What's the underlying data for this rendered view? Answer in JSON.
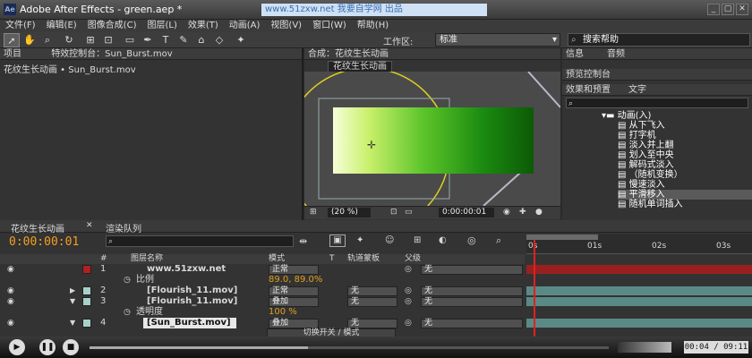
{
  "title": "Adobe After Effects - green.aep *",
  "watermark": "www.51zxw.net 我要自学网 出品",
  "window_buttons": [
    "_",
    "▢",
    "✕"
  ],
  "menu": [
    "文件(F)",
    "编辑(E)",
    "图像合成(C)",
    "图层(L)",
    "效果(T)",
    "动画(A)",
    "视图(V)",
    "窗口(W)",
    "帮助(H)"
  ],
  "toolbar": {
    "workspace_label": "工作区:",
    "workspace_value": "标准",
    "search_value": "搜索帮助"
  },
  "project_panel": {
    "tab": "项目",
    "fx_tab": "特效控制台：Sun_Burst.mov",
    "breadcrumb": "花纹生长动画 • Sun_Burst.mov"
  },
  "comp_panel": {
    "tab": "合成：花纹生长动画",
    "comp_label": "花纹生长动画",
    "zoom": "(20 %)",
    "timecode": "0:00:00:01"
  },
  "right_panel": {
    "tab_info": "信息",
    "tab_audio": "音频",
    "tab_preview": "预览控制台",
    "tab_effects": "效果和预置",
    "tab_text": "文字",
    "folder": "动画(入)",
    "items": [
      "从下飞入",
      "打字机",
      "淡入并上翻",
      "划入至中央",
      "解码式淡入",
      "（随机变换）",
      "慢速淡入",
      "平滑移入",
      "随机单词插入"
    ],
    "selected_item": "平滑移入"
  },
  "timeline": {
    "tab_comp": "花纹生长动画",
    "tab_render": "渲染队列",
    "timecode": "0:00:00:01",
    "columns": {
      "name": "图层名称",
      "mode": "模式",
      "t": "T",
      "trkmat": "轨道蒙板",
      "parent": "父级"
    },
    "ruler": [
      "0s",
      "01s",
      "02s",
      "03s"
    ],
    "layers": [
      {
        "num": "1",
        "name": "www.51zxw.net",
        "mode": "正常",
        "trkmat": "",
        "parent": "无",
        "color": "#b02020"
      },
      {
        "num": "",
        "name": "比例",
        "value": "89.0, 89.0%",
        "sub": true
      },
      {
        "num": "2",
        "name": "[Flourish_11.mov]",
        "mode": "正常",
        "trkmat": "无",
        "parent": "无",
        "color": "#a8d0c8"
      },
      {
        "num": "3",
        "name": "[Flourish_11.mov]",
        "mode": "叠加",
        "trkmat": "无",
        "parent": "无",
        "color": "#a8d0c8"
      },
      {
        "num": "",
        "name": "透明度",
        "value": "100 %",
        "sub": true
      },
      {
        "num": "4",
        "name": "[Sun_Burst.mov]",
        "mode": "叠加",
        "trkmat": "无",
        "parent": "无",
        "color": "#a8d0c8"
      }
    ],
    "switch_label": "切换开关 / 模式"
  },
  "player": {
    "time": "00:04 / 09:11",
    "progress": 0.42
  }
}
